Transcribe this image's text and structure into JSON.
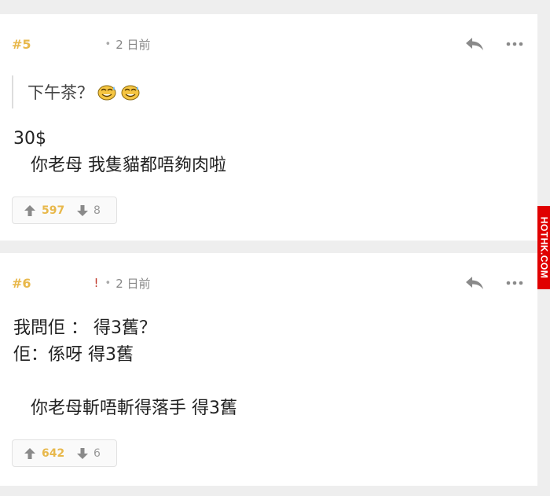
{
  "posts": [
    {
      "floor": "#5",
      "username": "",
      "separator": "•",
      "time": "2 日前",
      "quote": "下午茶？",
      "content": "30$\n　你老母 我隻貓都唔夠肉啦",
      "upvotes": "597",
      "downvotes": "8"
    },
    {
      "floor": "#6",
      "username": "!",
      "separator": "•",
      "time": "2 日前",
      "content": "我問佢 ： 得3舊？\n佢：係呀 得3舊\n\n　你老母斬唔斬得落手 得3舊",
      "upvotes": "642",
      "downvotes": "6"
    }
  ],
  "icons": {
    "reply": "reply-icon",
    "more": "more-dots-icon",
    "upvote": "arrow-up-icon",
    "downvote": "arrow-down-icon",
    "emoji": "sweat-emoji-icon"
  },
  "colors": {
    "floor": "#e8b84b",
    "username": "#c0392b",
    "upvote": "#e8b84b",
    "icon": "#8a8a8a"
  },
  "watermark": "HOTHK.COM"
}
